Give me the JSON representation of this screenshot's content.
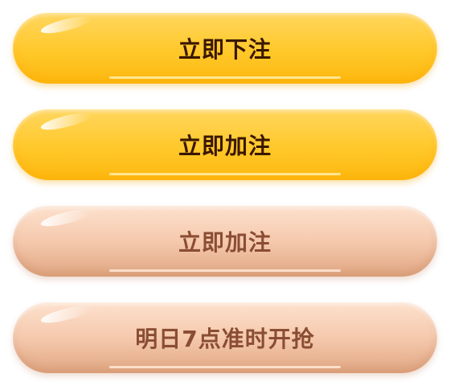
{
  "buttons": [
    {
      "label": "立即下注",
      "state": "active",
      "color": "#ffc82a"
    },
    {
      "label": "立即加注",
      "state": "active",
      "color": "#ffc82a"
    },
    {
      "label": "立即加注",
      "state": "disabled",
      "color": "#f5c9ad"
    },
    {
      "label": "明日7点准时开抢",
      "state": "disabled",
      "color": "#f5c9ad"
    }
  ]
}
